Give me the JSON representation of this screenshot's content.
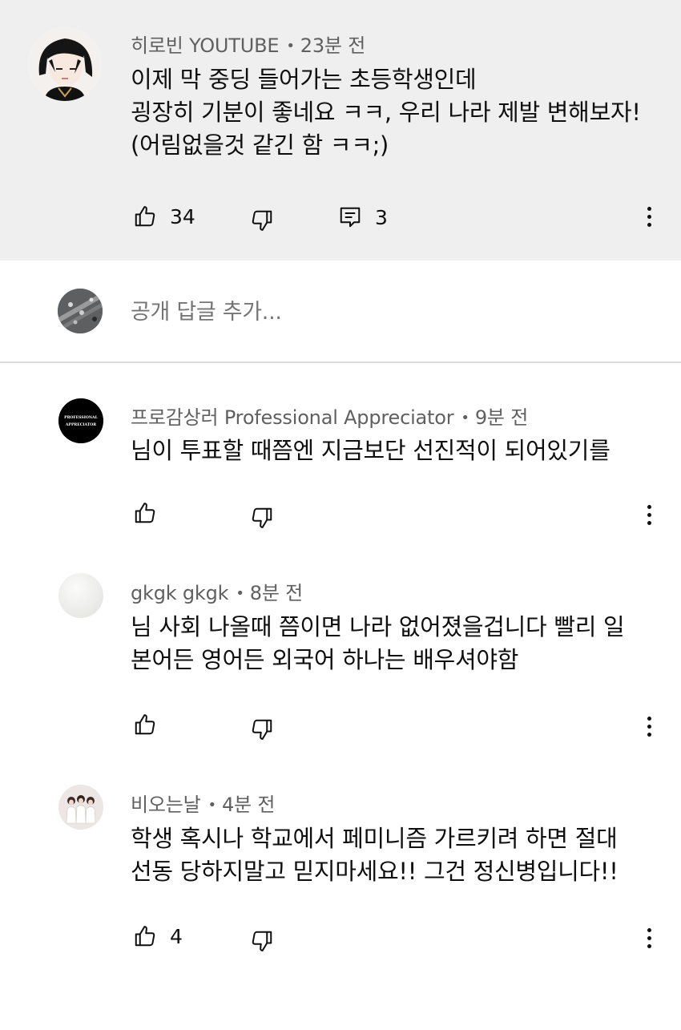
{
  "parent_comment": {
    "author": "히로빈 YOUTUBE",
    "time": "23분 전",
    "lines": [
      "이제 막 중딩 들어가는 초등학생인데",
      "굉장히 기분이 좋네요 ㅋㅋ, 우리 나라 제발 변해보자!",
      "(어림없을것 같긴 함 ㅋㅋ;)"
    ],
    "likes": "34",
    "replies": "3"
  },
  "reply_bar": {
    "placeholder": "공개 답글 추가..."
  },
  "replies": [
    {
      "author": "프로감상러 Professional Appreciator",
      "time": "9분 전",
      "lines": [
        "님이 투표할 때쯤엔 지금보단 선진적이 되어있기를"
      ],
      "likes": "",
      "avatar_text": [
        "PROFESSIONAL",
        "APPRECIATOR"
      ]
    },
    {
      "author": "gkgk gkgk",
      "time": "8분 전",
      "lines": [
        "님 사회 나올때 쯤이면 나라 없어졌을겁니다 빨리 일",
        "본어든 영어든 외국어 하나는 배우셔야함"
      ],
      "likes": ""
    },
    {
      "author": "비오는날",
      "time": "4분 전",
      "lines": [
        "학생 혹시나 학교에서 페미니즘 가르키려 하면 절대",
        "선동 당하지말고 믿지마세요!! 그건 정신병입니다!!"
      ],
      "likes": "4"
    }
  ],
  "icons": {
    "like": "thumbs-up-icon",
    "dislike": "thumbs-down-icon",
    "reply": "comment-icon",
    "more": "more-vertical-icon"
  },
  "colors": {
    "parent_bg": "#efefef",
    "meta_text": "#606060",
    "text": "#0f0f0f",
    "divider": "#dedede"
  }
}
